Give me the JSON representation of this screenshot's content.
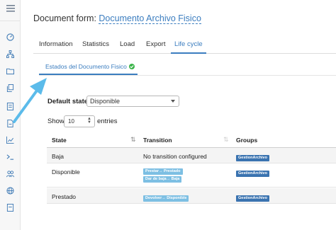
{
  "sidebar": {
    "items": [
      {
        "icon": "menu-icon"
      },
      {
        "icon": "dashboard-icon"
      },
      {
        "icon": "sitemap-icon"
      },
      {
        "icon": "folder-icon"
      },
      {
        "icon": "copy-icon"
      },
      {
        "icon": "document-icon"
      },
      {
        "icon": "file-icon"
      },
      {
        "icon": "chart-icon"
      },
      {
        "icon": "terminal-icon"
      },
      {
        "icon": "users-icon"
      },
      {
        "icon": "globe-icon"
      },
      {
        "icon": "page-icon"
      }
    ]
  },
  "header": {
    "prefix": "Document form:",
    "name": "Documento Archivo Fisico"
  },
  "tabs": [
    "Information",
    "Statistics",
    "Load",
    "Export",
    "Life cycle"
  ],
  "active_tab": "Life cycle",
  "subtab": {
    "label": "Estados del Documento Fisico"
  },
  "default_state": {
    "label": "Default state:",
    "value": "Disponible"
  },
  "show_entries": {
    "show": "Show",
    "value": "10",
    "suffix": "entries"
  },
  "table": {
    "columns": [
      "State",
      "Transition",
      "Groups"
    ],
    "rows": [
      {
        "state": "Baja",
        "transition_text": "No transition configured",
        "transitions": [],
        "groups": [
          "GestionArchivo"
        ]
      },
      {
        "state": "Disponible",
        "transition_text": "",
        "transitions": [
          "Prestar→ Prestado",
          "Dar de baja→ Baja"
        ],
        "groups": [
          "GestionArchivo"
        ]
      },
      {
        "state": "Prestado",
        "transition_text": "",
        "transitions": [
          "Devolver→ Disponible"
        ],
        "groups": [
          "GestionArchivo"
        ]
      }
    ]
  },
  "colors": {
    "accent": "#3b7dbf",
    "badge_light": "#7dbfe3",
    "badge_dark": "#3a73b0",
    "success": "#3bb44a",
    "arrow": "#5bbbea"
  }
}
